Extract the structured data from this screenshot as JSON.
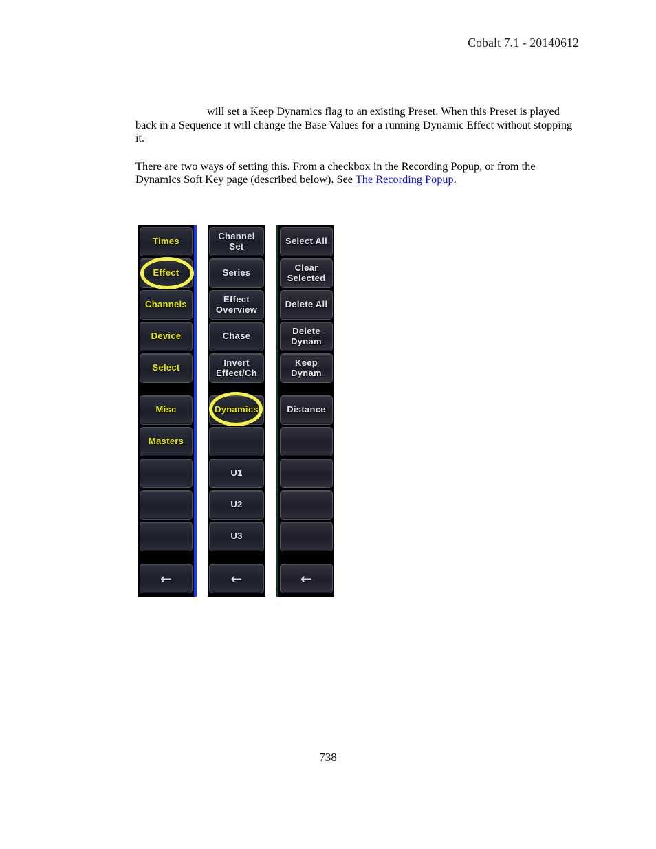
{
  "header": {
    "title": "Cobalt 7.1 - 20140612"
  },
  "content": {
    "paragraph1_lead": "will set a Keep Dynamics flag to an existing Preset. When this Preset is played back",
    "paragraph1_rest": "in a Sequence it will change the Base Values for a running Dynamic Effect without stopping it.",
    "paragraph2_before": "There are two ways of setting this. From a checkbox in the Recording Popup, or from the Dynamics Soft Key page (described below). See ",
    "paragraph2_link": "The Recording Popup",
    "paragraph2_after": "."
  },
  "softkeys": {
    "accent_blue": "#1a3ce8",
    "accent_green": "#123c23",
    "highlight_yellow": "#f2f24a",
    "label_yellow": "#e6e600",
    "label_white": "#e4e4ec",
    "back_arrow": "←",
    "columns": [
      {
        "id": "column-1",
        "style": "blue",
        "text_color": "yellow",
        "buttons": [
          {
            "label": "Times",
            "empty": false,
            "highlighted": false
          },
          {
            "label": "Effect",
            "empty": false,
            "highlighted": true
          },
          {
            "label": "Channels",
            "empty": false,
            "highlighted": false
          },
          {
            "label": "Device",
            "empty": false,
            "highlighted": false
          },
          {
            "label": "Select",
            "empty": false,
            "highlighted": false
          },
          {
            "label": "Misc",
            "empty": false,
            "highlighted": false
          },
          {
            "label": "Masters",
            "empty": false,
            "highlighted": false
          },
          {
            "label": "",
            "empty": true,
            "highlighted": false
          },
          {
            "label": "",
            "empty": true,
            "highlighted": false
          },
          {
            "label": "",
            "empty": true,
            "highlighted": false
          },
          {
            "label": "←",
            "empty": false,
            "highlighted": false
          }
        ]
      },
      {
        "id": "column-2",
        "style": "plain",
        "text_color": "white",
        "buttons": [
          {
            "label": "Channel Set",
            "empty": false,
            "highlighted": false
          },
          {
            "label": "Series",
            "empty": false,
            "highlighted": false
          },
          {
            "label": "Effect Overview",
            "empty": false,
            "highlighted": false
          },
          {
            "label": "Chase",
            "empty": false,
            "highlighted": false
          },
          {
            "label": "Invert Effect/Ch",
            "empty": false,
            "highlighted": false
          },
          {
            "label": "Dynamics",
            "empty": false,
            "highlighted": true
          },
          {
            "label": "",
            "empty": true,
            "highlighted": false
          },
          {
            "label": "U1",
            "empty": false,
            "highlighted": false
          },
          {
            "label": "U2",
            "empty": false,
            "highlighted": false
          },
          {
            "label": "U3",
            "empty": false,
            "highlighted": false
          },
          {
            "label": "←",
            "empty": false,
            "highlighted": false
          }
        ]
      },
      {
        "id": "column-3",
        "style": "green",
        "text_color": "white",
        "buttons": [
          {
            "label": "Select All",
            "empty": false,
            "highlighted": false
          },
          {
            "label": "Clear Selected",
            "empty": false,
            "highlighted": false
          },
          {
            "label": "Delete All",
            "empty": false,
            "highlighted": false
          },
          {
            "label": "Delete Dynam",
            "empty": false,
            "highlighted": false
          },
          {
            "label": "Keep Dynam",
            "empty": false,
            "highlighted": false
          },
          {
            "label": "Distance",
            "empty": false,
            "highlighted": false
          },
          {
            "label": "",
            "empty": true,
            "highlighted": false
          },
          {
            "label": "",
            "empty": true,
            "highlighted": false
          },
          {
            "label": "",
            "empty": true,
            "highlighted": false
          },
          {
            "label": "",
            "empty": true,
            "highlighted": false
          },
          {
            "label": "←",
            "empty": false,
            "highlighted": false
          }
        ]
      }
    ]
  },
  "footer": {
    "page_number": "738"
  }
}
